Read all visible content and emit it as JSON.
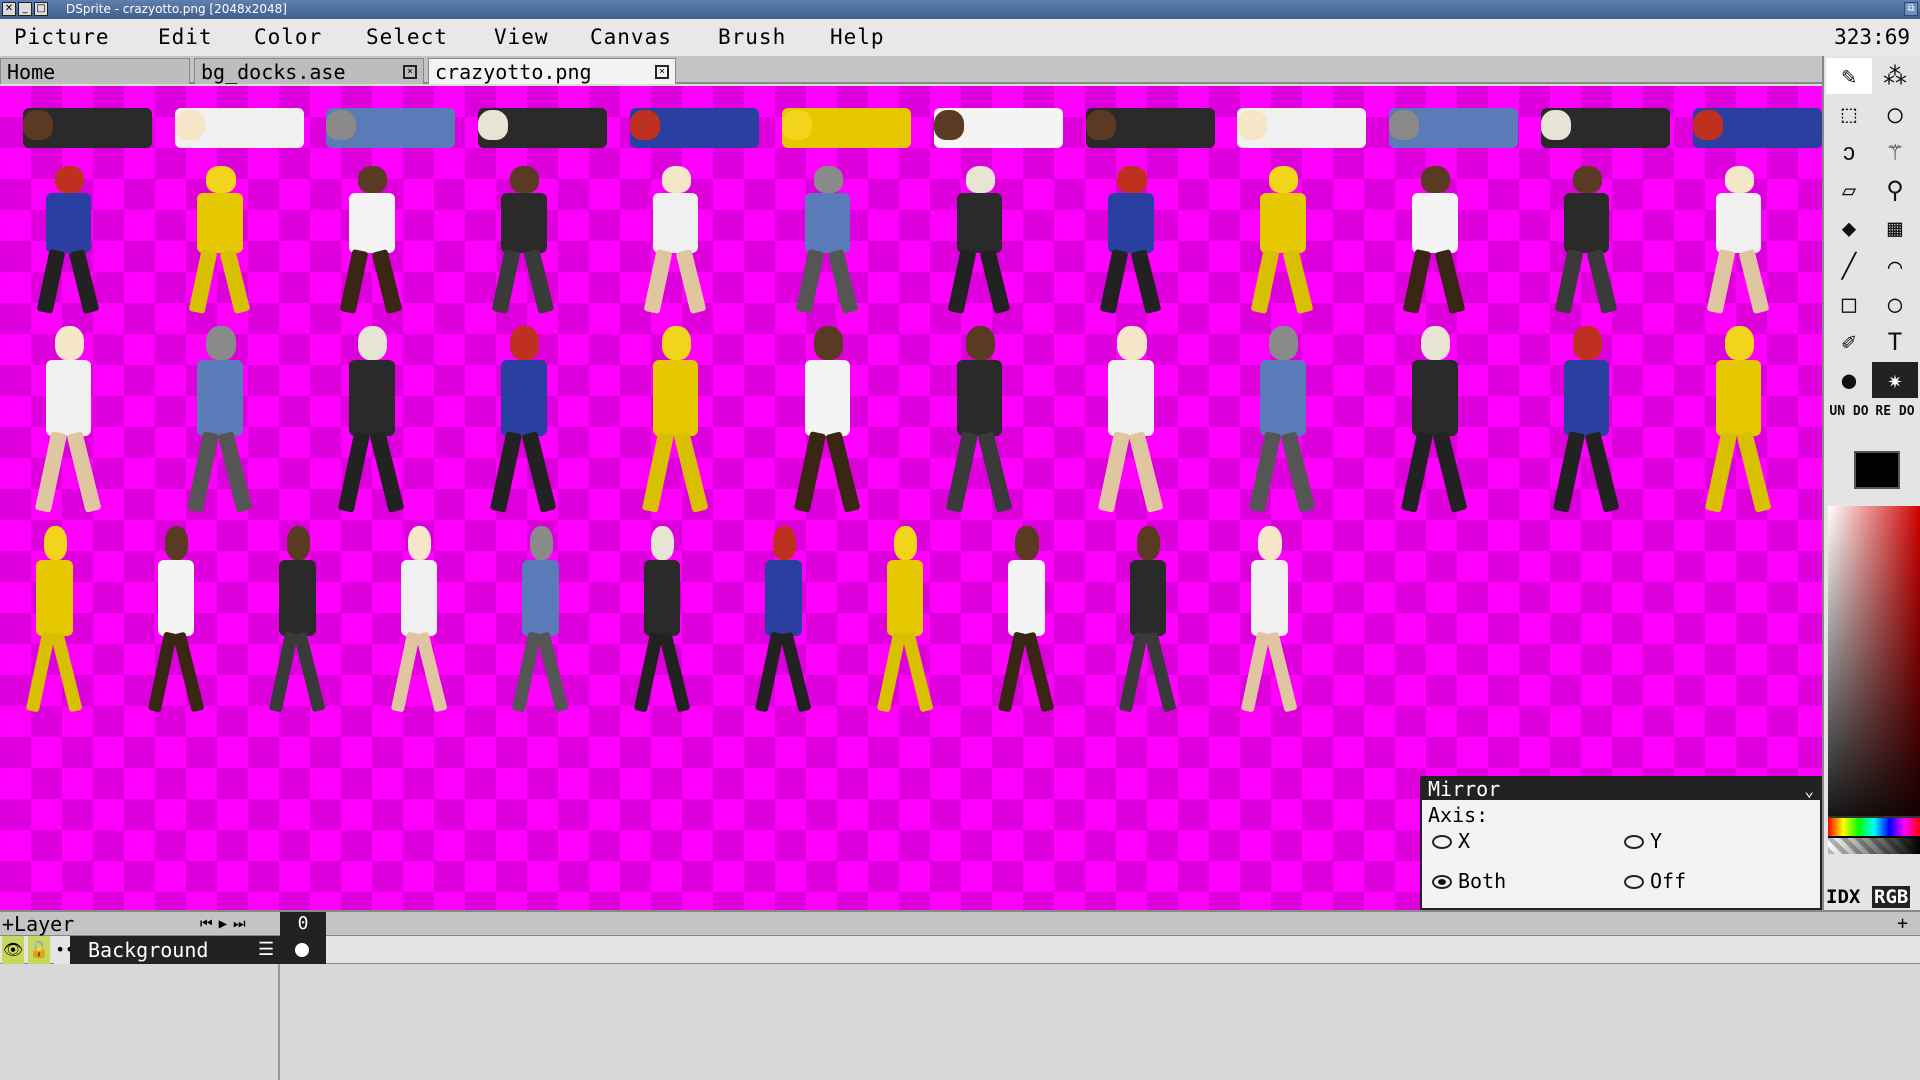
{
  "window": {
    "title": "DSprite - crazyotto.png [2048x2048]",
    "buttons": [
      "close-icon",
      "minimize-icon",
      "maximize-icon"
    ]
  },
  "menu": {
    "items": [
      "Picture",
      "Edit",
      "Color",
      "Select",
      "View",
      "Canvas",
      "Brush",
      "Help"
    ],
    "coords": "323:69"
  },
  "tabs": [
    {
      "label": "Home",
      "active": false,
      "closable": false
    },
    {
      "label": "bg_docks.ase",
      "active": false,
      "closable": true
    },
    {
      "label": "crazyotto.png",
      "active": true,
      "closable": true
    }
  ],
  "toolbox": {
    "tools": [
      {
        "icon": "pencil-icon",
        "selected": true
      },
      {
        "icon": "spray-icon",
        "selected": false
      },
      {
        "icon": "rect-select-icon",
        "selected": false
      },
      {
        "icon": "ellipse-select-icon",
        "selected": false
      },
      {
        "icon": "lasso-icon",
        "selected": false
      },
      {
        "icon": "magic-wand-icon",
        "selected": false
      },
      {
        "icon": "eraser-icon",
        "selected": false
      },
      {
        "icon": "eyedropper-icon",
        "selected": false
      },
      {
        "icon": "fill-bucket-icon",
        "selected": false
      },
      {
        "icon": "gradient-icon",
        "selected": false
      },
      {
        "icon": "line-icon",
        "selected": false
      },
      {
        "icon": "curve-icon",
        "selected": false
      },
      {
        "icon": "rectangle-icon",
        "selected": false
      },
      {
        "icon": "ellipse-icon",
        "selected": false
      },
      {
        "icon": "contour-icon",
        "selected": false
      },
      {
        "icon": "text-icon",
        "selected": false
      },
      {
        "icon": "blur-icon",
        "selected": false
      },
      {
        "icon": "jumble-icon",
        "selected": false
      }
    ],
    "undo_label": "UN DO",
    "redo_label": "RE DO",
    "foreground_color": "#000000",
    "mode_idx": "IDX",
    "mode_rgb": "RGB"
  },
  "mirror_panel": {
    "title": "Mirror",
    "axis_label": "Axis:",
    "options": [
      {
        "label": "X",
        "checked": false
      },
      {
        "label": "Y",
        "checked": false
      },
      {
        "label": "Both",
        "checked": true
      },
      {
        "label": "Off",
        "checked": false
      }
    ]
  },
  "timeline": {
    "add_layer_label": "+Layer",
    "frame_number": "0",
    "add_frame_label": "+",
    "layer": {
      "name": "Background",
      "visible": true,
      "locked": false
    }
  },
  "canvas": {
    "background_color": "#ff00ff"
  }
}
